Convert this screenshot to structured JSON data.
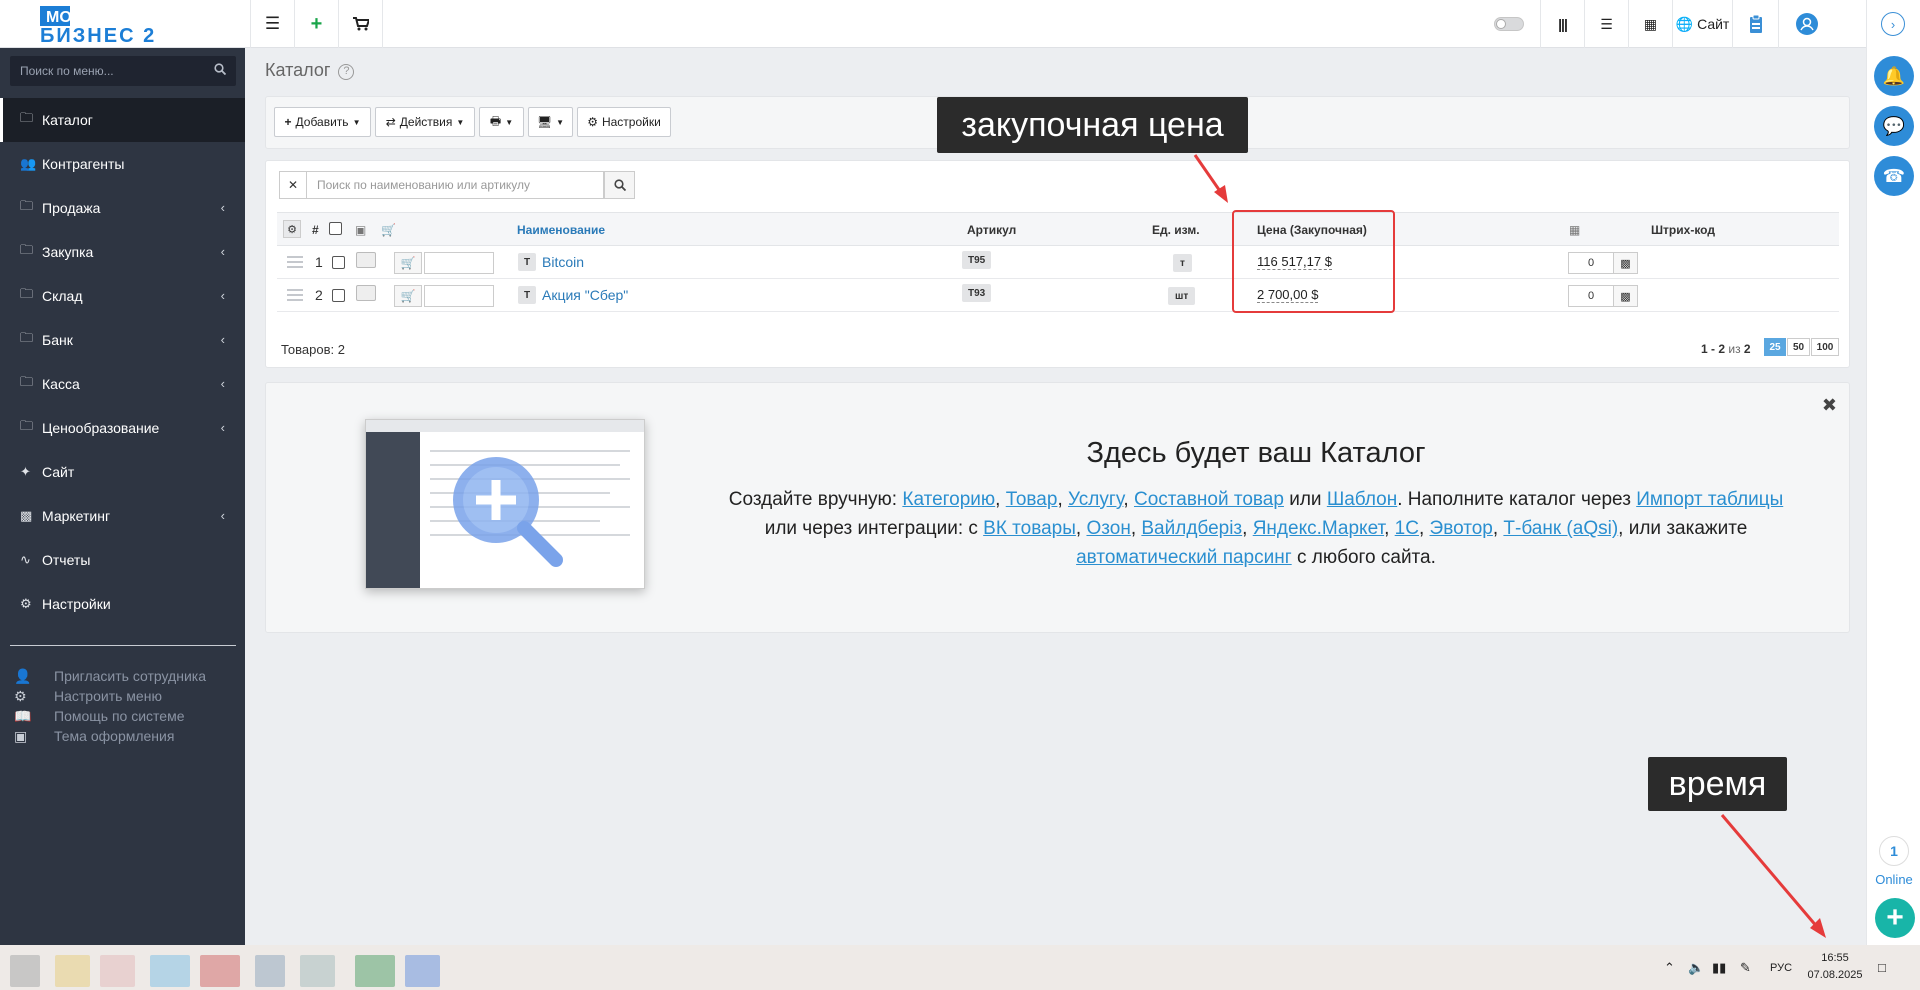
{
  "header": {
    "logo_line1": "МОЙ",
    "logo_line2": "БИЗНЕС 2",
    "site_label": "Сайт"
  },
  "sidebar": {
    "search_placeholder": "Поиск по меню...",
    "items": [
      {
        "label": "Каталог",
        "icon": "folder-icon",
        "active": true,
        "chevron": false
      },
      {
        "label": "Контрагенты",
        "icon": "users-icon",
        "chevron": false
      },
      {
        "label": "Продажа",
        "icon": "folder-icon",
        "chevron": true
      },
      {
        "label": "Закупка",
        "icon": "folder-icon",
        "chevron": true
      },
      {
        "label": "Склад",
        "icon": "folder-icon",
        "chevron": true
      },
      {
        "label": "Банк",
        "icon": "folder-icon",
        "chevron": true
      },
      {
        "label": "Касса",
        "icon": "folder-icon",
        "chevron": true
      },
      {
        "label": "Ценообразование",
        "icon": "folder-icon",
        "chevron": true
      },
      {
        "label": "Сайт",
        "icon": "magic-wand-icon",
        "chevron": false
      },
      {
        "label": "Маркетинг",
        "icon": "bar-chart-icon",
        "chevron": true
      },
      {
        "label": "Отчеты",
        "icon": "line-chart-icon",
        "chevron": false
      },
      {
        "label": "Настройки",
        "icon": "gear-icon",
        "chevron": false
      }
    ],
    "tools": [
      {
        "label": "Пригласить сотрудника",
        "icon": "user-plus-icon"
      },
      {
        "label": "Настроить меню",
        "icon": "cogs-icon"
      },
      {
        "label": "Помощь по системе",
        "icon": "book-icon"
      },
      {
        "label": "Тема оформления",
        "icon": "picture-icon"
      }
    ]
  },
  "page": {
    "title": "Каталог",
    "help": "?"
  },
  "toolbar": {
    "add_label": "Добавить",
    "actions_label": "Действия",
    "settings_label": "Настройки"
  },
  "table": {
    "search_placeholder": "Поиск по наименованию или артикулу",
    "headers": {
      "num": "#",
      "name": "Наименование",
      "sku": "Артикул",
      "unit": "Ед. изм.",
      "price": "Цена (Закупочная)",
      "barcode": "Штрих-код"
    },
    "rows": [
      {
        "num": "1",
        "type": "Т",
        "name": "Bitcoin",
        "sku": "Т95",
        "unit": "т",
        "price": "116 517,17 $",
        "stock": "0"
      },
      {
        "num": "2",
        "type": "Т",
        "name": "Акция \"Сбер\"",
        "sku": "Т93",
        "unit": "шт",
        "price": "2 700,00 $",
        "stock": "0"
      }
    ],
    "total": "Товаров: 2",
    "pager_range": "1 - 2",
    "pager_of": "из",
    "pager_total": "2",
    "page_sizes": [
      "25",
      "50",
      "100"
    ],
    "active_page_size": "25"
  },
  "promo": {
    "title": "Здесь будет ваш Каталог",
    "t1": "Создайте вручную: ",
    "l_category": "Категорию",
    "s1": ", ",
    "l_product": "Товар",
    "s2": ", ",
    "l_service": "Услугу",
    "s3": ", ",
    "l_composite": "Составной товар",
    "t2": " или ",
    "l_template": "Шаблон",
    "t3": ". Наполните каталог через ",
    "l_import": "Импорт таблицы",
    "t4": " или через интеграции: с ",
    "l_vk": "ВК товары",
    "s4": ", ",
    "l_ozon": "Озон",
    "s5": ", ",
    "l_wb": "Вайлдберiз",
    "s6": ", ",
    "l_ym": "Яндекс.Маркет",
    "s7": ", ",
    "l_1c": "1С",
    "s8": ", ",
    "l_evotor": "Эвотор",
    "s9": ", ",
    "l_tbank": "Т-банк (aQsi)",
    "t5": ", или закажите ",
    "l_parsing": "автоматический парсинг",
    "t6": " с любого сайта."
  },
  "annotations": {
    "price_callout": "закупочная цена",
    "time_callout": "время",
    "color": "#e53b3b"
  },
  "rail": {
    "online_count": "1",
    "online_label": "Online"
  },
  "taskbar": {
    "lang": "РУС",
    "time": "16:55",
    "date": "07.08.2025"
  },
  "colors": {
    "sidebar_bg": "#2e3542",
    "accent": "#2e8cd8",
    "link": "#2a7ab8",
    "plus": "#18b5a8"
  }
}
